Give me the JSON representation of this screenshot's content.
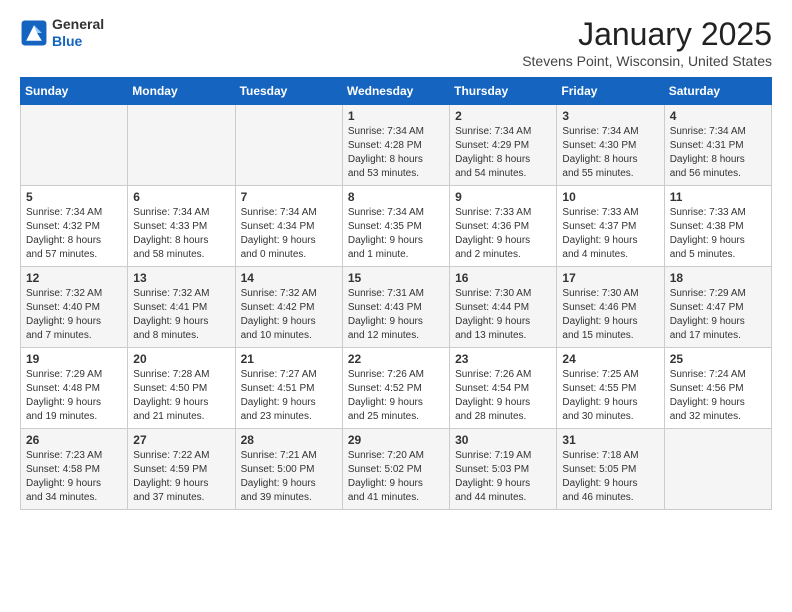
{
  "header": {
    "logo_general": "General",
    "logo_blue": "Blue",
    "month_title": "January 2025",
    "subtitle": "Stevens Point, Wisconsin, United States"
  },
  "weekdays": [
    "Sunday",
    "Monday",
    "Tuesday",
    "Wednesday",
    "Thursday",
    "Friday",
    "Saturday"
  ],
  "weeks": [
    [
      {
        "day": "",
        "info": ""
      },
      {
        "day": "",
        "info": ""
      },
      {
        "day": "",
        "info": ""
      },
      {
        "day": "1",
        "info": "Sunrise: 7:34 AM\nSunset: 4:28 PM\nDaylight: 8 hours\nand 53 minutes."
      },
      {
        "day": "2",
        "info": "Sunrise: 7:34 AM\nSunset: 4:29 PM\nDaylight: 8 hours\nand 54 minutes."
      },
      {
        "day": "3",
        "info": "Sunrise: 7:34 AM\nSunset: 4:30 PM\nDaylight: 8 hours\nand 55 minutes."
      },
      {
        "day": "4",
        "info": "Sunrise: 7:34 AM\nSunset: 4:31 PM\nDaylight: 8 hours\nand 56 minutes."
      }
    ],
    [
      {
        "day": "5",
        "info": "Sunrise: 7:34 AM\nSunset: 4:32 PM\nDaylight: 8 hours\nand 57 minutes."
      },
      {
        "day": "6",
        "info": "Sunrise: 7:34 AM\nSunset: 4:33 PM\nDaylight: 8 hours\nand 58 minutes."
      },
      {
        "day": "7",
        "info": "Sunrise: 7:34 AM\nSunset: 4:34 PM\nDaylight: 9 hours\nand 0 minutes."
      },
      {
        "day": "8",
        "info": "Sunrise: 7:34 AM\nSunset: 4:35 PM\nDaylight: 9 hours\nand 1 minute."
      },
      {
        "day": "9",
        "info": "Sunrise: 7:33 AM\nSunset: 4:36 PM\nDaylight: 9 hours\nand 2 minutes."
      },
      {
        "day": "10",
        "info": "Sunrise: 7:33 AM\nSunset: 4:37 PM\nDaylight: 9 hours\nand 4 minutes."
      },
      {
        "day": "11",
        "info": "Sunrise: 7:33 AM\nSunset: 4:38 PM\nDaylight: 9 hours\nand 5 minutes."
      }
    ],
    [
      {
        "day": "12",
        "info": "Sunrise: 7:32 AM\nSunset: 4:40 PM\nDaylight: 9 hours\nand 7 minutes."
      },
      {
        "day": "13",
        "info": "Sunrise: 7:32 AM\nSunset: 4:41 PM\nDaylight: 9 hours\nand 8 minutes."
      },
      {
        "day": "14",
        "info": "Sunrise: 7:32 AM\nSunset: 4:42 PM\nDaylight: 9 hours\nand 10 minutes."
      },
      {
        "day": "15",
        "info": "Sunrise: 7:31 AM\nSunset: 4:43 PM\nDaylight: 9 hours\nand 12 minutes."
      },
      {
        "day": "16",
        "info": "Sunrise: 7:30 AM\nSunset: 4:44 PM\nDaylight: 9 hours\nand 13 minutes."
      },
      {
        "day": "17",
        "info": "Sunrise: 7:30 AM\nSunset: 4:46 PM\nDaylight: 9 hours\nand 15 minutes."
      },
      {
        "day": "18",
        "info": "Sunrise: 7:29 AM\nSunset: 4:47 PM\nDaylight: 9 hours\nand 17 minutes."
      }
    ],
    [
      {
        "day": "19",
        "info": "Sunrise: 7:29 AM\nSunset: 4:48 PM\nDaylight: 9 hours\nand 19 minutes."
      },
      {
        "day": "20",
        "info": "Sunrise: 7:28 AM\nSunset: 4:50 PM\nDaylight: 9 hours\nand 21 minutes."
      },
      {
        "day": "21",
        "info": "Sunrise: 7:27 AM\nSunset: 4:51 PM\nDaylight: 9 hours\nand 23 minutes."
      },
      {
        "day": "22",
        "info": "Sunrise: 7:26 AM\nSunset: 4:52 PM\nDaylight: 9 hours\nand 25 minutes."
      },
      {
        "day": "23",
        "info": "Sunrise: 7:26 AM\nSunset: 4:54 PM\nDaylight: 9 hours\nand 28 minutes."
      },
      {
        "day": "24",
        "info": "Sunrise: 7:25 AM\nSunset: 4:55 PM\nDaylight: 9 hours\nand 30 minutes."
      },
      {
        "day": "25",
        "info": "Sunrise: 7:24 AM\nSunset: 4:56 PM\nDaylight: 9 hours\nand 32 minutes."
      }
    ],
    [
      {
        "day": "26",
        "info": "Sunrise: 7:23 AM\nSunset: 4:58 PM\nDaylight: 9 hours\nand 34 minutes."
      },
      {
        "day": "27",
        "info": "Sunrise: 7:22 AM\nSunset: 4:59 PM\nDaylight: 9 hours\nand 37 minutes."
      },
      {
        "day": "28",
        "info": "Sunrise: 7:21 AM\nSunset: 5:00 PM\nDaylight: 9 hours\nand 39 minutes."
      },
      {
        "day": "29",
        "info": "Sunrise: 7:20 AM\nSunset: 5:02 PM\nDaylight: 9 hours\nand 41 minutes."
      },
      {
        "day": "30",
        "info": "Sunrise: 7:19 AM\nSunset: 5:03 PM\nDaylight: 9 hours\nand 44 minutes."
      },
      {
        "day": "31",
        "info": "Sunrise: 7:18 AM\nSunset: 5:05 PM\nDaylight: 9 hours\nand 46 minutes."
      },
      {
        "day": "",
        "info": ""
      }
    ]
  ]
}
